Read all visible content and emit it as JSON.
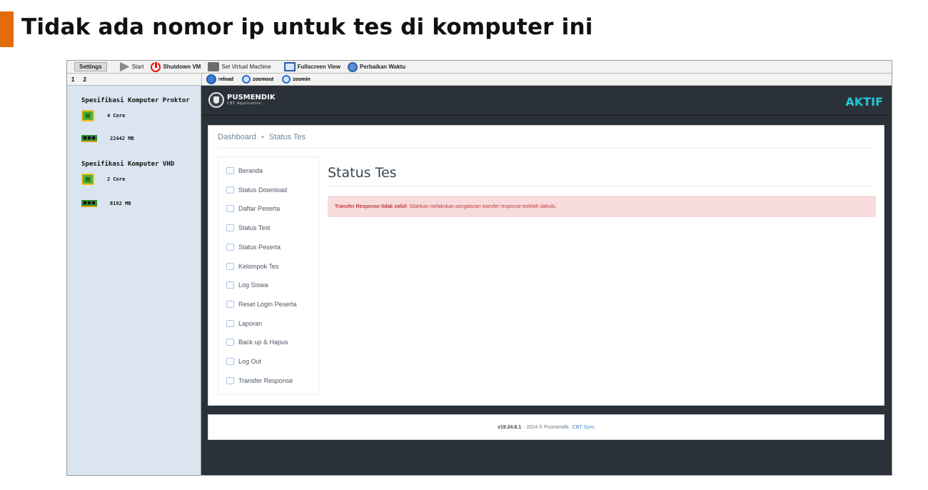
{
  "slide": {
    "title": "Tidak ada nomor ip untuk tes di komputer ini"
  },
  "toolbar": {
    "settings": "Settings",
    "start": "Start",
    "shutdown": "Shutdown VM",
    "set_vm": "Set Virtual Machine",
    "fullscreen": "Fullscreen View",
    "perbaikan": "Perbaikan Waktu"
  },
  "sidebar_tabs": [
    "1",
    "2"
  ],
  "toolbar2": {
    "reload": "reload",
    "zoomout": "zoomout",
    "zoomin": "zoomin"
  },
  "specs": {
    "proktor": {
      "title": "Spesifikasi Komputer Proktor",
      "cpu": "4 Core",
      "ram": "22442 MB"
    },
    "vhd": {
      "title": "Spesifikasi Komputer VHD",
      "cpu": "2 Core",
      "ram": "8192 MB"
    }
  },
  "app": {
    "logo": "PUSMENDIK",
    "logo_sub": "CBT Application",
    "status": "AKTIF",
    "accent_color": "#24c6d6",
    "breadcrumb": {
      "home": "Dashboard",
      "separator": "•",
      "current": "Status Tes"
    },
    "menu": [
      {
        "label": "Beranda",
        "icon": "home-icon"
      },
      {
        "label": "Status Download",
        "icon": "cloud-icon"
      },
      {
        "label": "Daftar Peserta",
        "icon": "copy-icon"
      },
      {
        "label": "Status Test",
        "icon": "edit-icon"
      },
      {
        "label": "Status Peserta",
        "icon": "user-icon"
      },
      {
        "label": "Kelompok Tes",
        "icon": "user-icon"
      },
      {
        "label": "Log Siswa",
        "icon": "copy-icon"
      },
      {
        "label": "Reset Login Peserta",
        "icon": "refresh-icon"
      },
      {
        "label": "Laporan",
        "icon": "printer-icon"
      },
      {
        "label": "Back up & Hapus",
        "icon": "gear-icon"
      },
      {
        "label": "Log Out",
        "icon": "logout-icon"
      },
      {
        "label": "Transfer Response",
        "icon": "rss-icon"
      }
    ],
    "content_title": "Status Tes",
    "alert": {
      "strong": "Transfer Response tidak valid!",
      "text": "Silahkan melakukan pengaturan transfer response terlebih dahulu."
    },
    "footer": {
      "version": "v19.24.6.1",
      "text": "- 2024 © Pusmendik.",
      "link": "CBT Sync"
    }
  }
}
